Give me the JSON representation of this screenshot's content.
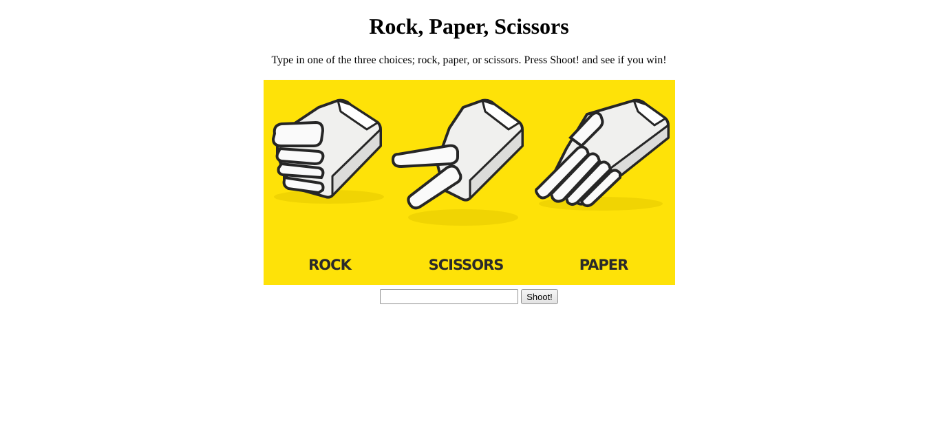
{
  "page": {
    "title": "Rock, Paper, Scissors",
    "instructions": "Type in one of the three choices; rock, paper, or scissors. Press Shoot! and see if you win!"
  },
  "banner": {
    "background_color": "#FEE208",
    "labels": [
      "ROCK",
      "SCISSORS",
      "PAPER"
    ]
  },
  "form": {
    "choice_value": "",
    "choice_placeholder": "",
    "shoot_label": "Shoot!"
  }
}
